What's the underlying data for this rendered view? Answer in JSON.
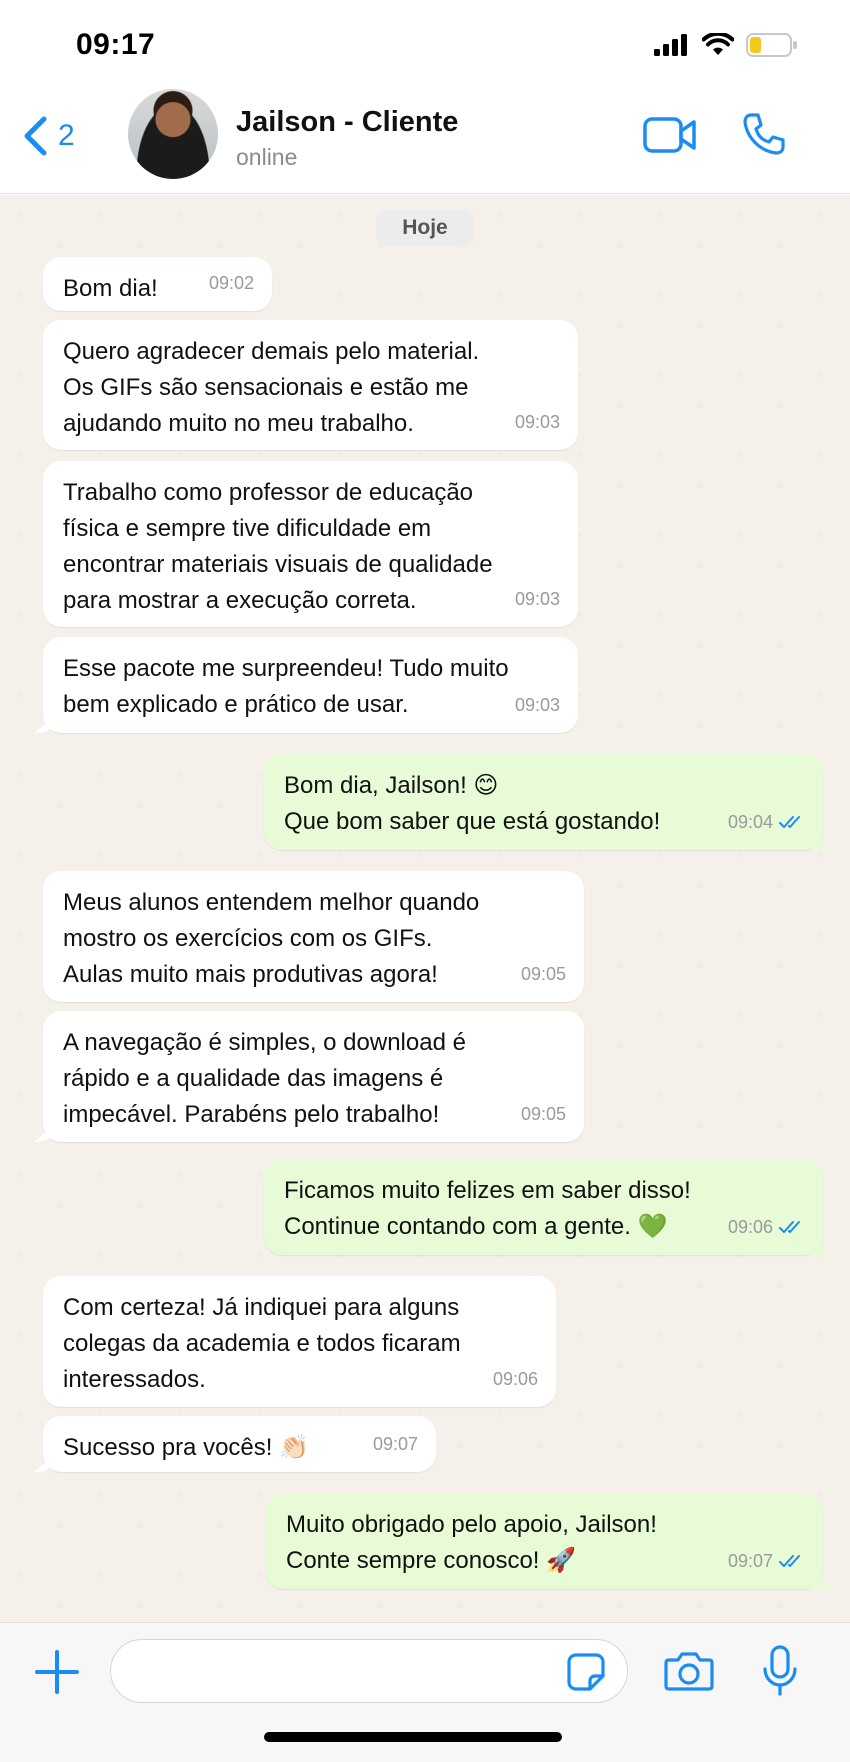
{
  "status_bar": {
    "time": "09:17"
  },
  "header": {
    "back_count": "2",
    "contact_name": "Jailson - Cliente",
    "contact_status": "online"
  },
  "chat": {
    "day_label": "Hoje",
    "messages": [
      {
        "direction": "in",
        "lines": [
          "Bom dia!"
        ],
        "time": "09:02"
      },
      {
        "direction": "in",
        "lines": [
          "Quero agradecer demais pelo material.",
          "Os GIFs são sensacionais e estão me",
          "ajudando muito no meu trabalho."
        ],
        "time": "09:03"
      },
      {
        "direction": "in",
        "lines": [
          "Trabalho como professor de educação",
          "física e sempre tive dificuldade em",
          "encontrar materiais visuais de qualidade",
          "para mostrar a execução correta."
        ],
        "time": "09:03"
      },
      {
        "direction": "in",
        "lines": [
          "Esse pacote me surpreendeu! Tudo muito",
          "bem explicado e prático de usar."
        ],
        "time": "09:03"
      },
      {
        "direction": "out",
        "lines": [
          "Bom dia, Jailson! 😊",
          "Que bom saber que está gostando!"
        ],
        "time": "09:04",
        "status": "read"
      },
      {
        "direction": "in",
        "lines": [
          "Meus alunos entendem melhor quando",
          "mostro os exercícios com os GIFs.",
          "Aulas muito mais produtivas agora!"
        ],
        "time": "09:05"
      },
      {
        "direction": "in",
        "lines": [
          "A navegação é simples, o download é",
          "rápido e a qualidade das imagens é",
          "impecável. Parabéns pelo trabalho!"
        ],
        "time": "09:05"
      },
      {
        "direction": "out",
        "lines": [
          "Ficamos muito felizes em saber disso!",
          "Continue contando com a gente. 💚"
        ],
        "time": "09:06",
        "status": "read"
      },
      {
        "direction": "in",
        "lines": [
          "Com certeza! Já indiquei para alguns",
          "colegas da academia e todos ficaram",
          "interessados."
        ],
        "time": "09:06"
      },
      {
        "direction": "in",
        "lines": [
          "Sucesso pra vocês! 👏🏻"
        ],
        "time": "09:07"
      },
      {
        "direction": "out",
        "lines": [
          "Muito obrigado pelo apoio, Jailson!",
          "Conte sempre conosco! 🚀"
        ],
        "time": "09:07",
        "status": "read"
      }
    ]
  },
  "input_bar": {
    "placeholder": ""
  },
  "colors": {
    "accent": "#1b8cf2",
    "outgoing_bubble": "#e7fbd7",
    "incoming_bubble": "#ffffff",
    "chat_background": "#f5f1ea",
    "battery_level": "#f4c81e"
  },
  "icons": [
    "signal-icon",
    "wifi-icon",
    "battery-icon",
    "back-chevron-icon",
    "video-call-icon",
    "phone-icon",
    "read-receipt-icon",
    "plus-icon",
    "sticker-icon",
    "camera-icon",
    "microphone-icon"
  ]
}
